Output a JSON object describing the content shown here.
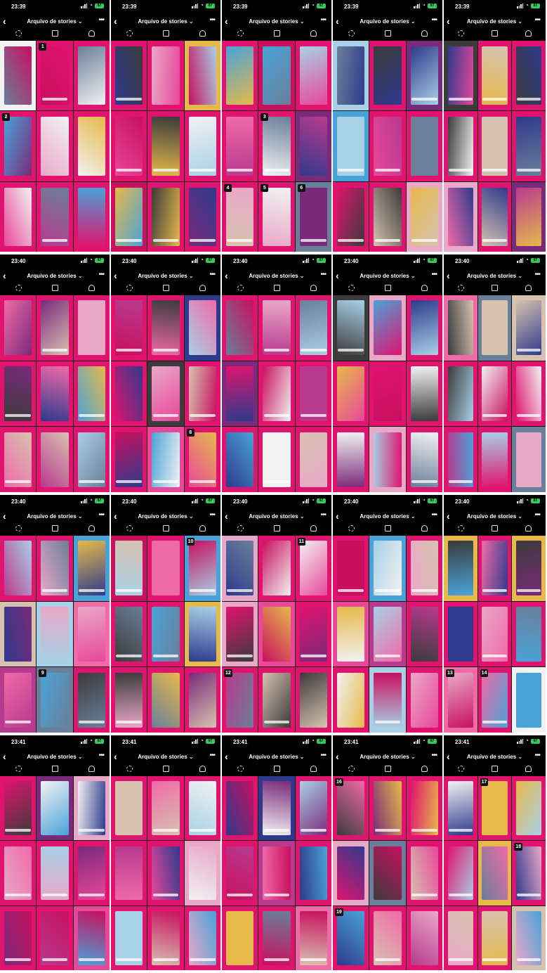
{
  "screens": [
    {
      "time": "23:39",
      "title": "Arquivo de stories",
      "badges": [
        [
          1,
          "1"
        ],
        [
          3,
          "2"
        ]
      ]
    },
    {
      "time": "23:39",
      "title": "Arquivo de stories",
      "badges": []
    },
    {
      "time": "23:39",
      "title": "Arquivo de stories",
      "badges": [
        [
          4,
          "3"
        ],
        [
          6,
          "4"
        ],
        [
          7,
          "5"
        ],
        [
          8,
          "6"
        ]
      ]
    },
    {
      "time": "23:39",
      "title": "Arquivo de stories",
      "badges": []
    },
    {
      "time": "23:39",
      "title": "Arquivo de stories",
      "badges": []
    },
    {
      "time": "23:40",
      "title": "Arquivo de stories",
      "badges": []
    },
    {
      "time": "23:40",
      "title": "Arquivo de stories",
      "badges": [
        [
          8,
          "8"
        ]
      ]
    },
    {
      "time": "23:40",
      "title": "Arquivo de stories",
      "badges": []
    },
    {
      "time": "23:40",
      "title": "Arquivo de stories",
      "badges": []
    },
    {
      "time": "23:40",
      "title": "Arquivo de stories",
      "badges": []
    },
    {
      "time": "23:40",
      "title": "Arquivo de stories",
      "badges": [
        [
          7,
          "9"
        ]
      ]
    },
    {
      "time": "23:40",
      "title": "Arquivo de stories",
      "badges": [
        [
          2,
          "10"
        ]
      ]
    },
    {
      "time": "23:40",
      "title": "Arquivo de stories",
      "badges": [
        [
          2,
          "11"
        ],
        [
          6,
          "12"
        ]
      ]
    },
    {
      "time": "23:40",
      "title": "Arquivo de stories",
      "badges": []
    },
    {
      "time": "23:40",
      "title": "Arquivo de stories",
      "badges": [
        [
          6,
          "13"
        ],
        [
          7,
          "14"
        ]
      ]
    },
    {
      "time": "23:41",
      "title": "Arquivo de stories",
      "badges": []
    },
    {
      "time": "23:41",
      "title": "Arquivo de stories",
      "badges": []
    },
    {
      "time": "23:41",
      "title": "Arquivo de stories",
      "badges": []
    },
    {
      "time": "23:41",
      "title": "Arquivo de stories",
      "badges": [
        [
          0,
          "16"
        ],
        [
          6,
          "19"
        ]
      ]
    },
    {
      "time": "23:41",
      "title": "Arquivo de stories",
      "badges": [
        [
          1,
          "17"
        ],
        [
          5,
          "18"
        ]
      ]
    }
  ],
  "colors": {
    "pink": "#e0136f",
    "magenta": "#d21a8c",
    "dark": "#000000",
    "battery": "#35c759"
  },
  "icons": [
    "back-icon",
    "more-icon",
    "highlights-icon",
    "calendar-icon",
    "profile-icon",
    "signal-icon",
    "wifi-icon",
    "battery-icon"
  ],
  "battery_label": "67"
}
